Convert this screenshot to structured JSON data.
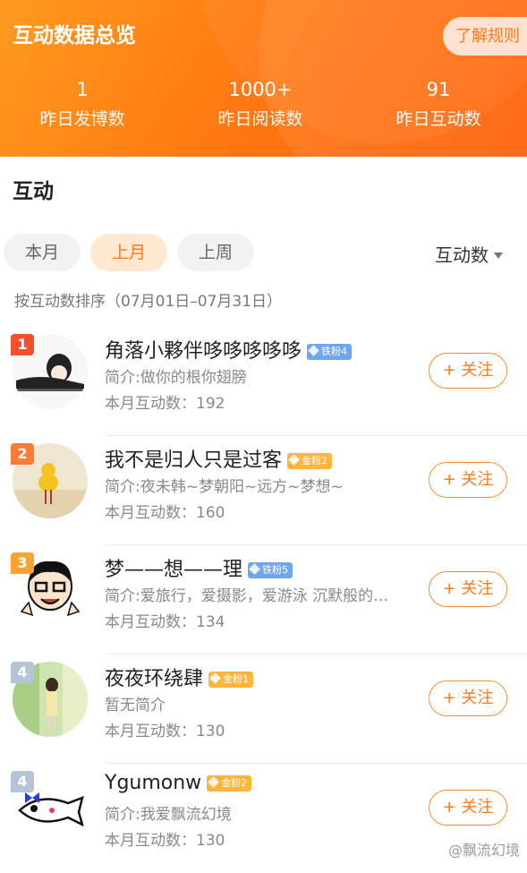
{
  "header": {
    "title": "互动数据总览",
    "rules_button": "了解规则",
    "stats": [
      {
        "value": "1",
        "label": "昨日发博数"
      },
      {
        "value": "1000+",
        "label": "昨日阅读数"
      },
      {
        "value": "91",
        "label": "昨日互动数"
      }
    ]
  },
  "section": {
    "title": "互动"
  },
  "filters": {
    "chips": [
      "本月",
      "上月",
      "上周"
    ],
    "active": "上月",
    "sort_label": "互动数"
  },
  "range_text": "按互动数排序（07月01日–07月31日）",
  "follow_label": "+ 关注",
  "users": [
    {
      "rank": "1",
      "name": "角落小夥伴哆哆哆哆哆",
      "badge": "铁粉4",
      "bio": "简介:做你的根你翅膀",
      "count": "本月互动数：192"
    },
    {
      "rank": "2",
      "name": "我不是归人只是过客",
      "badge": "金粉2",
      "bio": "简介:夜未韩~梦朝阳~远方~梦想~",
      "count": "本月互动数：160"
    },
    {
      "rank": "3",
      "name": "梦——想——理",
      "badge": "铁粉5",
      "bio": "简介:爱旅行，爱摄影，爱游泳 沉默般的…",
      "count": "本月互动数：134"
    },
    {
      "rank": "4",
      "name": "夜夜环绕肆",
      "badge": "金粉1",
      "bio": "暂无简介",
      "count": "本月互动数：130"
    },
    {
      "rank": "4",
      "name": "Ygumonw",
      "badge": "金粉2",
      "bio": "简介:我爱飘流幻境",
      "count": "本月互动数：130"
    }
  ],
  "colors": {
    "rank1": "#f5502d",
    "rank2": "#ff7b33",
    "rank3": "#ffa22d",
    "rank4": "#b6c2d6",
    "iron_badge": "#6fa6ef",
    "gold_badge": "#ffb43a",
    "accent": "#ff7a1a"
  },
  "watermark": "@飘流幻境"
}
